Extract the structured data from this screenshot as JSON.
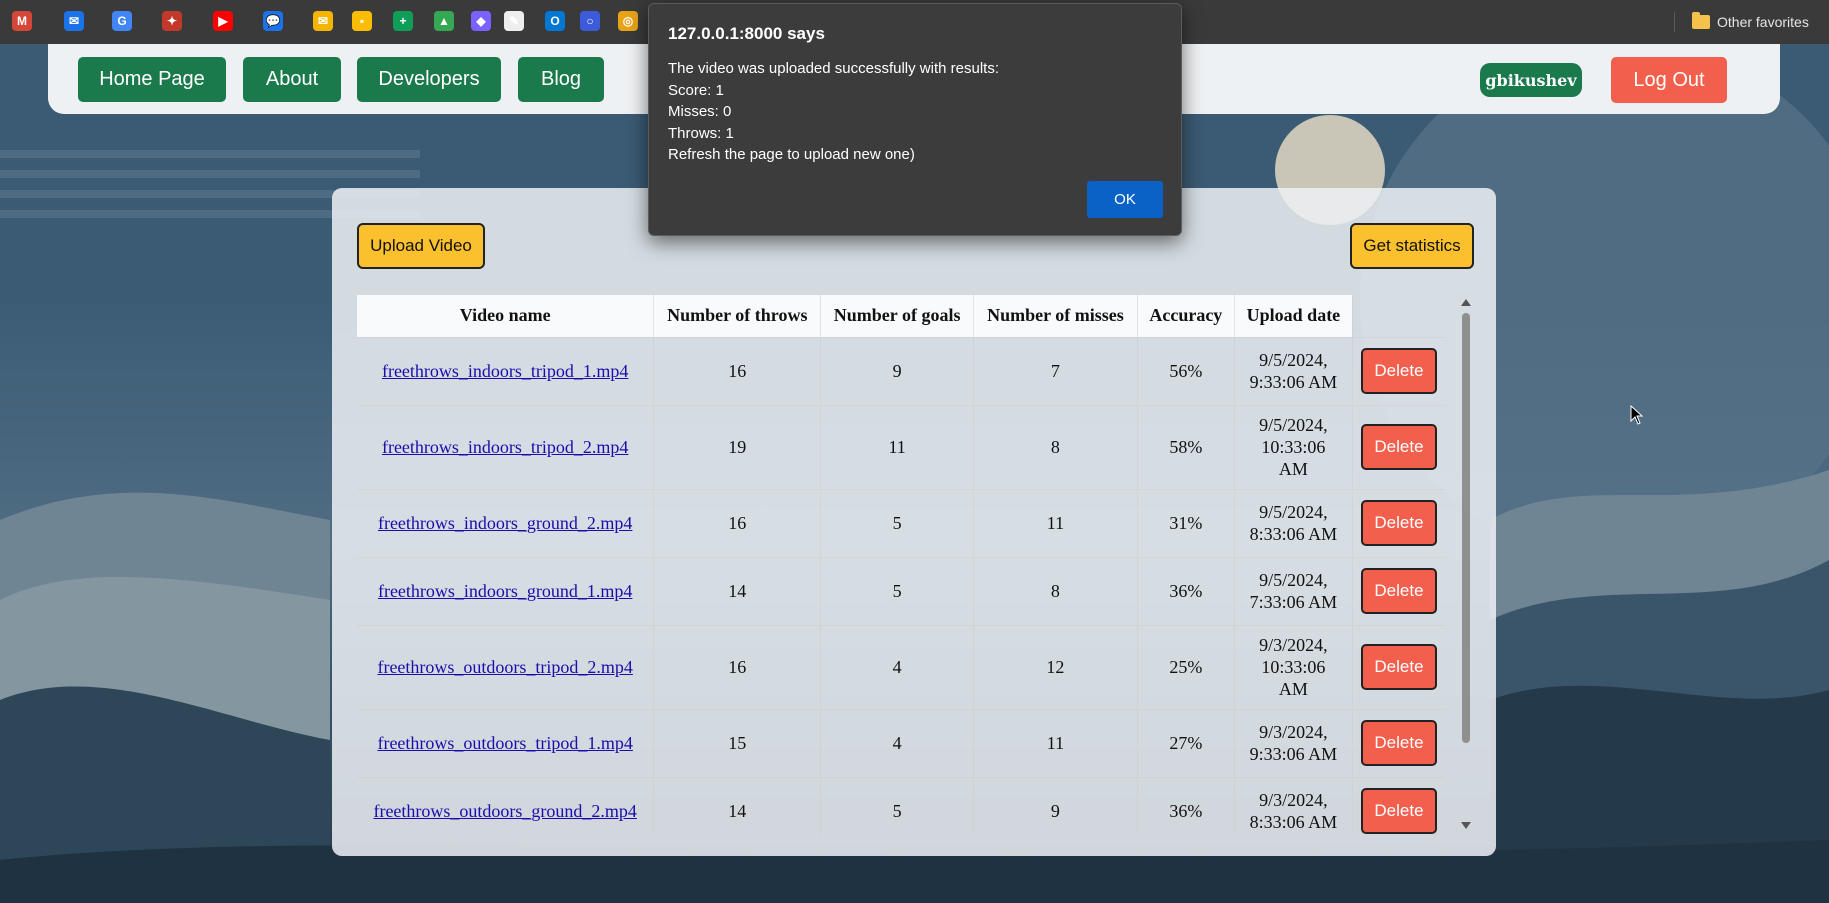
{
  "bookmarks": {
    "icons": [
      {
        "name": "gmail-icon",
        "color": "#d44638",
        "glyph": "M"
      },
      {
        "name": "mail-icon",
        "color": "#1a73e8",
        "glyph": "✉"
      },
      {
        "name": "translate-icon",
        "color": "#4285f4",
        "glyph": "G"
      },
      {
        "name": "app-icon",
        "color": "#c0392b",
        "glyph": "✦"
      },
      {
        "name": "youtube-icon",
        "color": "#ff0000",
        "glyph": "▶"
      },
      {
        "name": "chat-icon",
        "color": "#1a73e8",
        "glyph": "💬"
      },
      {
        "name": "gmail-alt-icon",
        "color": "#f4b400",
        "glyph": "✉"
      },
      {
        "name": "keep-icon",
        "color": "#fbbc04",
        "glyph": "▪"
      },
      {
        "name": "sheets-icon",
        "color": "#0f9d58",
        "glyph": "+"
      },
      {
        "name": "drive-icon",
        "color": "#34a853",
        "glyph": "▲"
      },
      {
        "name": "puzzle-icon",
        "color": "#7b61ff",
        "glyph": "◆"
      },
      {
        "name": "document-icon",
        "color": "#eeeeee",
        "glyph": "✎"
      },
      {
        "name": "outlook-icon",
        "color": "#0078d4",
        "glyph": "O"
      },
      {
        "name": "circle-icon",
        "color": "#3b5bdb",
        "glyph": "○"
      },
      {
        "name": "chrome-icon",
        "color": "#e8a317",
        "glyph": "◎"
      }
    ],
    "other_favorites": "Other favorites"
  },
  "nav": {
    "home": "Home Page",
    "about": "About",
    "developers": "Developers",
    "blog": "Blog",
    "username": "gbikushev",
    "logout": "Log Out"
  },
  "panel": {
    "upload": "Upload Video",
    "stats": "Get statistics"
  },
  "table": {
    "headers": [
      "Video name",
      "Number of throws",
      "Number of goals",
      "Number of misses",
      "Accuracy",
      "Upload date"
    ],
    "delete_label": "Delete",
    "rows": [
      {
        "name": "freethrows_indoors_tripod_1.mp4",
        "throws": "16",
        "goals": "9",
        "misses": "7",
        "accuracy": "56%",
        "date": [
          "9/5/2024,",
          "9:33:06 AM"
        ]
      },
      {
        "name": "freethrows_indoors_tripod_2.mp4",
        "throws": "19",
        "goals": "11",
        "misses": "8",
        "accuracy": "58%",
        "date": [
          "9/5/2024,",
          "10:33:06",
          "AM"
        ]
      },
      {
        "name": "freethrows_indoors_ground_2.mp4",
        "throws": "16",
        "goals": "5",
        "misses": "11",
        "accuracy": "31%",
        "date": [
          "9/5/2024,",
          "8:33:06 AM"
        ]
      },
      {
        "name": "freethrows_indoors_ground_1.mp4",
        "throws": "14",
        "goals": "5",
        "misses": "8",
        "accuracy": "36%",
        "date": [
          "9/5/2024,",
          "7:33:06 AM"
        ]
      },
      {
        "name": "freethrows_outdoors_tripod_2.mp4",
        "throws": "16",
        "goals": "4",
        "misses": "12",
        "accuracy": "25%",
        "date": [
          "9/3/2024,",
          "10:33:06",
          "AM"
        ]
      },
      {
        "name": "freethrows_outdoors_tripod_1.mp4",
        "throws": "15",
        "goals": "4",
        "misses": "11",
        "accuracy": "27%",
        "date": [
          "9/3/2024,",
          "9:33:06 AM"
        ]
      },
      {
        "name": "freethrows_outdoors_ground_2.mp4",
        "throws": "14",
        "goals": "5",
        "misses": "9",
        "accuracy": "36%",
        "date": [
          "9/3/2024,",
          "8:33:06 AM"
        ]
      }
    ]
  },
  "alert": {
    "title": "127.0.0.1:8000 says",
    "lines": [
      "The video was uploaded successfully with results:",
      "Score: 1",
      "Misses: 0",
      "Throws: 1",
      "Refresh the page to upload new one)"
    ],
    "ok": "OK"
  },
  "colors": {
    "nav_green": "#1b7a4c",
    "logout_red": "#f25f4c",
    "action_yellow": "#fbc02d",
    "dialog_bg": "#3c3c3c",
    "ok_blue": "#0a62c7"
  }
}
